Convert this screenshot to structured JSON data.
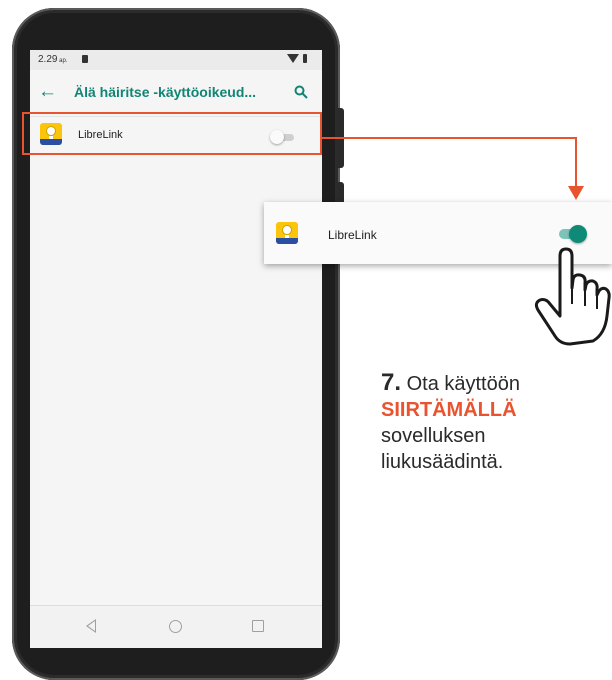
{
  "status_bar": {
    "time": "2.29",
    "time_suffix": "ap."
  },
  "app_bar": {
    "back_icon": "arrow-back-icon",
    "title": "Älä häiritse -käyttöoikeud...",
    "search_icon": "search-icon"
  },
  "app_list": {
    "items": [
      {
        "label": "LibreLink",
        "icon": "librelink-app-icon",
        "toggle_on": false
      }
    ]
  },
  "zoom_callout": {
    "label": "LibreLink",
    "icon": "librelink-app-icon",
    "toggle_on": true
  },
  "instruction": {
    "step": "7.",
    "line1": "Ota käyttöön",
    "emphasis": "SIIRTÄMÄLLÄ",
    "line3": "sovelluksen",
    "line4": "liukusäädintä."
  },
  "colors": {
    "accent_teal": "#118575",
    "highlight_orange": "#e8542f",
    "app_icon_yellow": "#fcc40a",
    "app_icon_blue": "#2a4fa2"
  }
}
